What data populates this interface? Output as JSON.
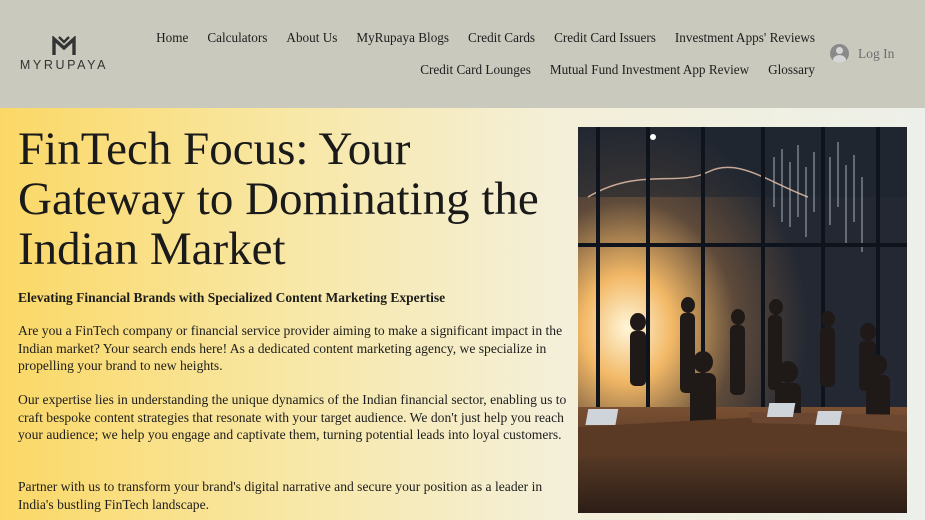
{
  "brand": {
    "name": "MYRUPAYA"
  },
  "nav": {
    "row1": [
      "Home",
      "Calculators",
      "About Us",
      "MyRupaya Blogs",
      "Credit Cards",
      "Credit Card Issuers",
      "Investment Apps' Reviews"
    ],
    "row2": [
      "Credit Card Lounges",
      "Mutual Fund Investment App Review",
      "Glossary"
    ]
  },
  "login": {
    "label": "Log In"
  },
  "hero": {
    "title": "FinTech Focus: Your Gateway to Dominating the Indian Market",
    "subtitle": "Elevating Financial Brands with Specialized Content Marketing Expertise",
    "paragraphs": [
      "Are you a FinTech company or financial service provider aiming to make a significant impact in the Indian market? Your search ends here! As a dedicated content marketing agency, we specialize in propelling your brand to new heights.",
      "Our expertise lies in understanding the unique dynamics of the Indian financial sector, enabling us to craft bespoke content strategies that resonate with your target audience. We don't just help you reach your audience; we help you engage and captivate them, turning potential leads into loyal customers.",
      "Partner with us to transform your brand's digital narrative and secure your position as a leader in India's bustling FinTech landscape."
    ]
  },
  "colors": {
    "header_bg": "#c9cabd",
    "hero_gradient_start": "#fbd866",
    "hero_gradient_end": "#edf0ea"
  },
  "icons": {
    "logo": "m-logo-icon",
    "login": "user-avatar-icon"
  }
}
